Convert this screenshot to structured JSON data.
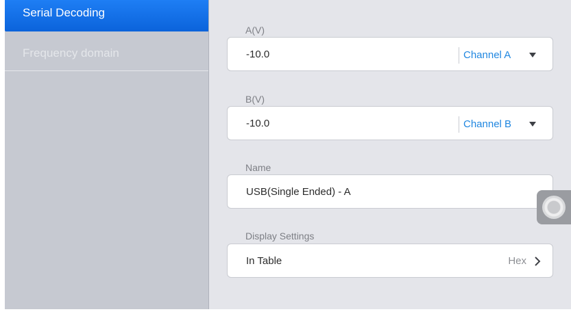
{
  "sidebar": {
    "items": [
      {
        "label": "Serial Decoding",
        "active": true
      },
      {
        "label": "Frequency domain",
        "active": false
      }
    ]
  },
  "form": {
    "a": {
      "label": "A(V)",
      "value": "-10.0",
      "channel": "Channel A"
    },
    "b": {
      "label": "B(V)",
      "value": "-10.0",
      "channel": "Channel B"
    },
    "name": {
      "label": "Name",
      "value": "USB(Single Ended) - A"
    },
    "display": {
      "label": "Display Settings",
      "value": "In Table",
      "format": "Hex"
    }
  },
  "icons": {
    "dropdown": "caret-down-icon",
    "chevron": "chevron-right-icon",
    "assistive": "assistive-touch-icon"
  },
  "colors": {
    "accent": "#1e7ef4",
    "link": "#1f86e0",
    "sidebar_bg": "#c6c9d1",
    "panel_bg": "#e4e5ea"
  }
}
